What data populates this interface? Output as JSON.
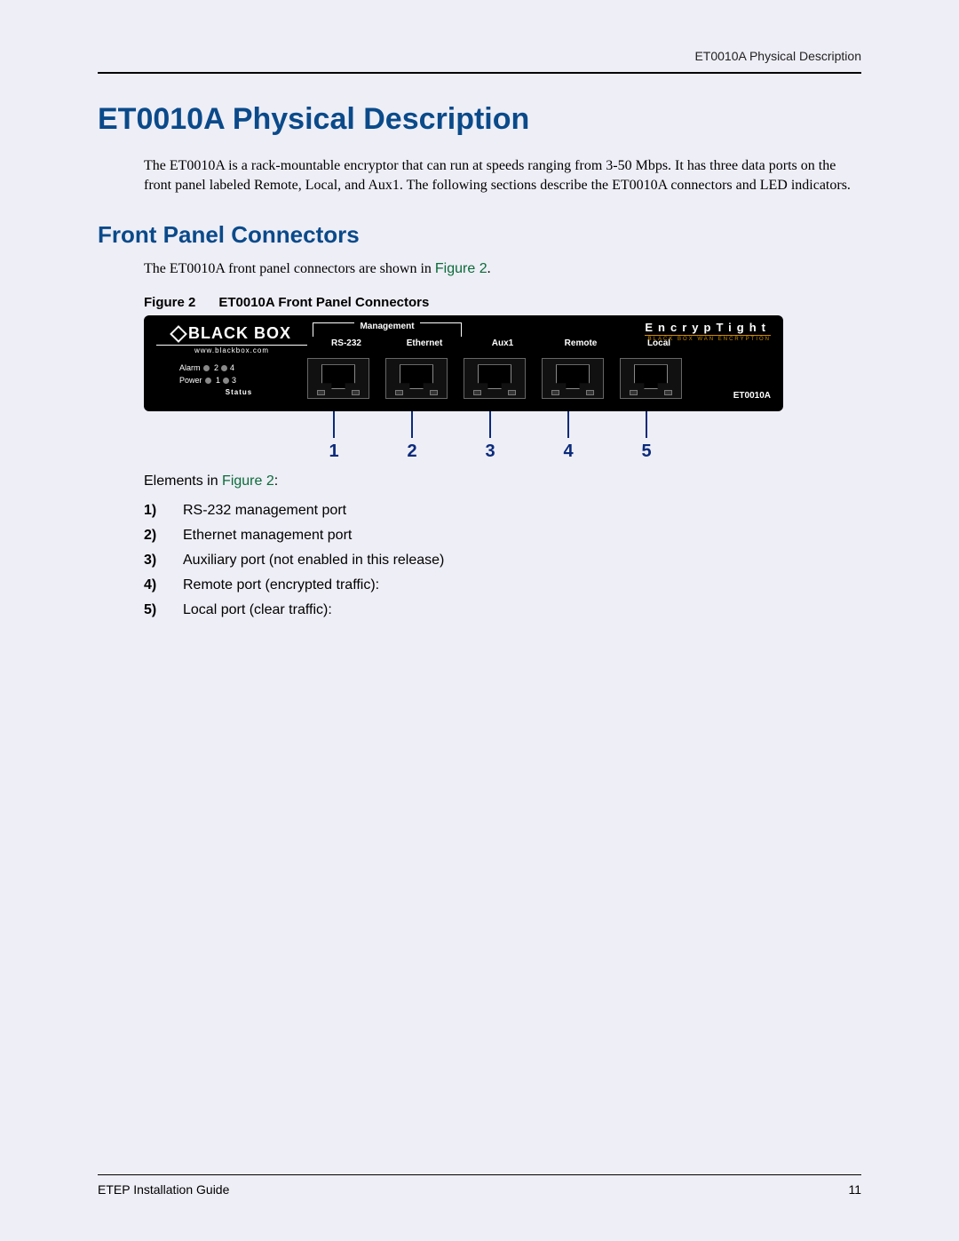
{
  "runningHead": "ET0010A Physical Description",
  "title": "ET0010A Physical Description",
  "intro": "The ET0010A is a rack-mountable encryptor that can run at speeds ranging from 3-50 Mbps. It has three data ports on the front panel labeled Remote, Local, and Aux1. The following sections describe the ET0010A connectors and LED indicators.",
  "section2": "Front Panel Connectors",
  "section2intro_a": "The ET0010A front panel connectors are shown in ",
  "section2intro_link": "Figure 2",
  "section2intro_b": ".",
  "figCaptionPrefix": "Figure 2",
  "figCaptionText": "ET0010A Front Panel Connectors",
  "device": {
    "brand": "BLACK BOX",
    "brandUrl": "www.blackbox.com",
    "mgmt": "Management",
    "portLabels": [
      "RS-232",
      "Ethernet",
      "Aux1",
      "Remote",
      "Local"
    ],
    "encrypBrand": "EncrypTight",
    "encrypSub": "BLACK BOX WAN ENCRYPTION",
    "alarmLabel": "Alarm",
    "powerLabel": "Power",
    "statusLabel": "Status",
    "statusNums": [
      "2",
      "4",
      "1",
      "3"
    ],
    "model": "ET0010A"
  },
  "callouts": [
    "1",
    "2",
    "3",
    "4",
    "5"
  ],
  "elementsIntro_a": "Elements in ",
  "elementsIntro_link": "Figure 2",
  "elementsIntro_b": ":",
  "elements": [
    {
      "n": "1)",
      "t": "RS-232 management port"
    },
    {
      "n": "2)",
      "t": "Ethernet management port"
    },
    {
      "n": "3)",
      "t": "Auxiliary port (not enabled in this release)"
    },
    {
      "n": "4)",
      "t": "Remote port (encrypted traffic):"
    },
    {
      "n": "5)",
      "t": "Local port (clear traffic):"
    }
  ],
  "footerLeft": "ETEP Installation Guide",
  "footerRight": "11"
}
